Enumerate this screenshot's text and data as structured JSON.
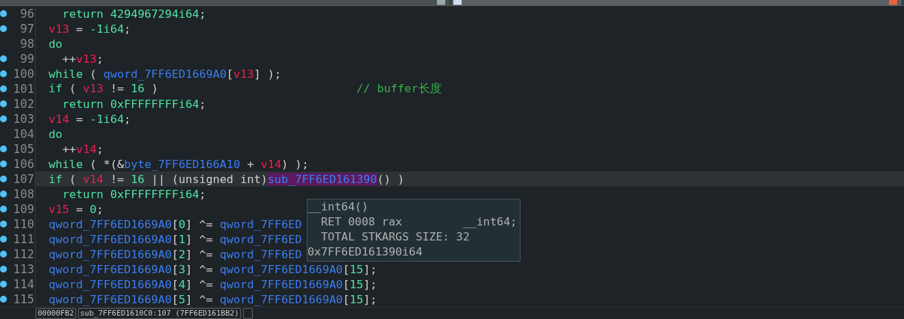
{
  "lines": [
    {
      "number": "96",
      "breakpoint": true,
      "selected": false,
      "tokens": [
        {
          "kind": "kw",
          "text": "  return "
        },
        {
          "kind": "num",
          "text": "4294967294i64"
        },
        {
          "kind": "punct",
          "text": ";"
        }
      ]
    },
    {
      "number": "97",
      "breakpoint": true,
      "selected": false,
      "tokens": [
        {
          "kind": "var",
          "text": "v13"
        },
        {
          "kind": "punct",
          "text": " = "
        },
        {
          "kind": "num",
          "text": "-1i64"
        },
        {
          "kind": "punct",
          "text": ";"
        }
      ]
    },
    {
      "number": "98",
      "breakpoint": false,
      "selected": false,
      "tokens": [
        {
          "kind": "kw",
          "text": "do"
        }
      ]
    },
    {
      "number": "99",
      "breakpoint": true,
      "selected": false,
      "tokens": [
        {
          "kind": "punct",
          "text": "  ++"
        },
        {
          "kind": "var",
          "text": "v13"
        },
        {
          "kind": "punct",
          "text": ";"
        }
      ]
    },
    {
      "number": "100",
      "breakpoint": true,
      "selected": false,
      "tokens": [
        {
          "kind": "kw",
          "text": "while"
        },
        {
          "kind": "punct",
          "text": " ( "
        },
        {
          "kind": "glob",
          "text": "qword_7FF6ED1669A0"
        },
        {
          "kind": "punct",
          "text": "["
        },
        {
          "kind": "var",
          "text": "v13"
        },
        {
          "kind": "punct",
          "text": "] );"
        }
      ]
    },
    {
      "number": "101",
      "breakpoint": true,
      "selected": false,
      "tokens": [
        {
          "kind": "kw",
          "text": "if"
        },
        {
          "kind": "punct",
          "text": " ( "
        },
        {
          "kind": "var",
          "text": "v13"
        },
        {
          "kind": "punct",
          "text": " != "
        },
        {
          "kind": "num",
          "text": "16"
        },
        {
          "kind": "punct",
          "text": " )                             "
        },
        {
          "kind": "comment",
          "text": "// buffer长度"
        }
      ]
    },
    {
      "number": "102",
      "breakpoint": true,
      "selected": false,
      "tokens": [
        {
          "kind": "kw",
          "text": "  return "
        },
        {
          "kind": "num",
          "text": "0xFFFFFFFFi64"
        },
        {
          "kind": "punct",
          "text": ";"
        }
      ]
    },
    {
      "number": "103",
      "breakpoint": true,
      "selected": false,
      "tokens": [
        {
          "kind": "var",
          "text": "v14"
        },
        {
          "kind": "punct",
          "text": " = "
        },
        {
          "kind": "num",
          "text": "-1i64"
        },
        {
          "kind": "punct",
          "text": ";"
        }
      ]
    },
    {
      "number": "104",
      "breakpoint": false,
      "selected": false,
      "tokens": [
        {
          "kind": "kw",
          "text": "do"
        }
      ]
    },
    {
      "number": "105",
      "breakpoint": true,
      "selected": false,
      "tokens": [
        {
          "kind": "punct",
          "text": "  ++"
        },
        {
          "kind": "var",
          "text": "v14"
        },
        {
          "kind": "punct",
          "text": ";"
        }
      ]
    },
    {
      "number": "106",
      "breakpoint": true,
      "selected": false,
      "tokens": [
        {
          "kind": "kw",
          "text": "while"
        },
        {
          "kind": "punct",
          "text": " ( *(&"
        },
        {
          "kind": "glob",
          "text": "byte_7FF6ED166A10"
        },
        {
          "kind": "punct",
          "text": " + "
        },
        {
          "kind": "var",
          "text": "v14"
        },
        {
          "kind": "punct",
          "text": ") );"
        }
      ]
    },
    {
      "number": "107",
      "breakpoint": true,
      "selected": true,
      "tokens": [
        {
          "kind": "kw",
          "text": "if"
        },
        {
          "kind": "punct",
          "text": " ( "
        },
        {
          "kind": "var",
          "text": "v14"
        },
        {
          "kind": "punct",
          "text": " != "
        },
        {
          "kind": "num",
          "text": "16"
        },
        {
          "kind": "punct",
          "text": " || (unsigned int)"
        },
        {
          "kind": "hl",
          "text": "sub_7FF6ED161390"
        },
        {
          "kind": "punct",
          "text": "() )"
        }
      ]
    },
    {
      "number": "108",
      "breakpoint": true,
      "selected": false,
      "tokens": [
        {
          "kind": "kw",
          "text": "  return "
        },
        {
          "kind": "num",
          "text": "0xFFFFFFFFi64"
        },
        {
          "kind": "punct",
          "text": ";"
        }
      ]
    },
    {
      "number": "109",
      "breakpoint": true,
      "selected": false,
      "tokens": [
        {
          "kind": "var",
          "text": "v15"
        },
        {
          "kind": "punct",
          "text": " = "
        },
        {
          "kind": "num",
          "text": "0"
        },
        {
          "kind": "punct",
          "text": ";"
        }
      ]
    },
    {
      "number": "110",
      "breakpoint": true,
      "selected": false,
      "tokens": [
        {
          "kind": "glob",
          "text": "qword_7FF6ED1669A0"
        },
        {
          "kind": "punct",
          "text": "["
        },
        {
          "kind": "num",
          "text": "0"
        },
        {
          "kind": "punct",
          "text": "] ^= "
        },
        {
          "kind": "glob",
          "text": "qword_7FF6ED"
        }
      ]
    },
    {
      "number": "111",
      "breakpoint": true,
      "selected": false,
      "tokens": [
        {
          "kind": "glob",
          "text": "qword_7FF6ED1669A0"
        },
        {
          "kind": "punct",
          "text": "["
        },
        {
          "kind": "num",
          "text": "1"
        },
        {
          "kind": "punct",
          "text": "] ^= "
        },
        {
          "kind": "glob",
          "text": "qword_7FF6ED"
        }
      ]
    },
    {
      "number": "112",
      "breakpoint": true,
      "selected": false,
      "tokens": [
        {
          "kind": "glob",
          "text": "qword_7FF6ED1669A0"
        },
        {
          "kind": "punct",
          "text": "["
        },
        {
          "kind": "num",
          "text": "2"
        },
        {
          "kind": "punct",
          "text": "] ^= "
        },
        {
          "kind": "glob",
          "text": "qword_7FF6ED"
        }
      ]
    },
    {
      "number": "113",
      "breakpoint": true,
      "selected": false,
      "tokens": [
        {
          "kind": "glob",
          "text": "qword_7FF6ED1669A0"
        },
        {
          "kind": "punct",
          "text": "["
        },
        {
          "kind": "num",
          "text": "3"
        },
        {
          "kind": "punct",
          "text": "] ^= "
        },
        {
          "kind": "glob",
          "text": "qword_7FF6ED1669A0"
        },
        {
          "kind": "punct",
          "text": "["
        },
        {
          "kind": "num",
          "text": "15"
        },
        {
          "kind": "punct",
          "text": "];"
        }
      ]
    },
    {
      "number": "114",
      "breakpoint": true,
      "selected": false,
      "tokens": [
        {
          "kind": "glob",
          "text": "qword_7FF6ED1669A0"
        },
        {
          "kind": "punct",
          "text": "["
        },
        {
          "kind": "num",
          "text": "4"
        },
        {
          "kind": "punct",
          "text": "] ^= "
        },
        {
          "kind": "glob",
          "text": "qword_7FF6ED1669A0"
        },
        {
          "kind": "punct",
          "text": "["
        },
        {
          "kind": "num",
          "text": "15"
        },
        {
          "kind": "punct",
          "text": "];"
        }
      ]
    },
    {
      "number": "115",
      "breakpoint": true,
      "selected": false,
      "tokens": [
        {
          "kind": "glob",
          "text": "qword_7FF6ED1669A0"
        },
        {
          "kind": "punct",
          "text": "["
        },
        {
          "kind": "num",
          "text": "5"
        },
        {
          "kind": "punct",
          "text": "] ^= "
        },
        {
          "kind": "glob",
          "text": "qword_7FF6ED1669A0"
        },
        {
          "kind": "punct",
          "text": "["
        },
        {
          "kind": "num",
          "text": "15"
        },
        {
          "kind": "punct",
          "text": "];"
        }
      ]
    }
  ],
  "tooltip": {
    "lines": [
      "__int64()",
      "  RET 0008 rax         __int64;",
      "  TOTAL STKARGS SIZE: 32",
      "0x7FF6ED161390i64"
    ]
  },
  "status_bar": {
    "address": "00000FB2",
    "location": "sub_7FF6ED1610C0:107 (7FF6ED161BB2)"
  }
}
